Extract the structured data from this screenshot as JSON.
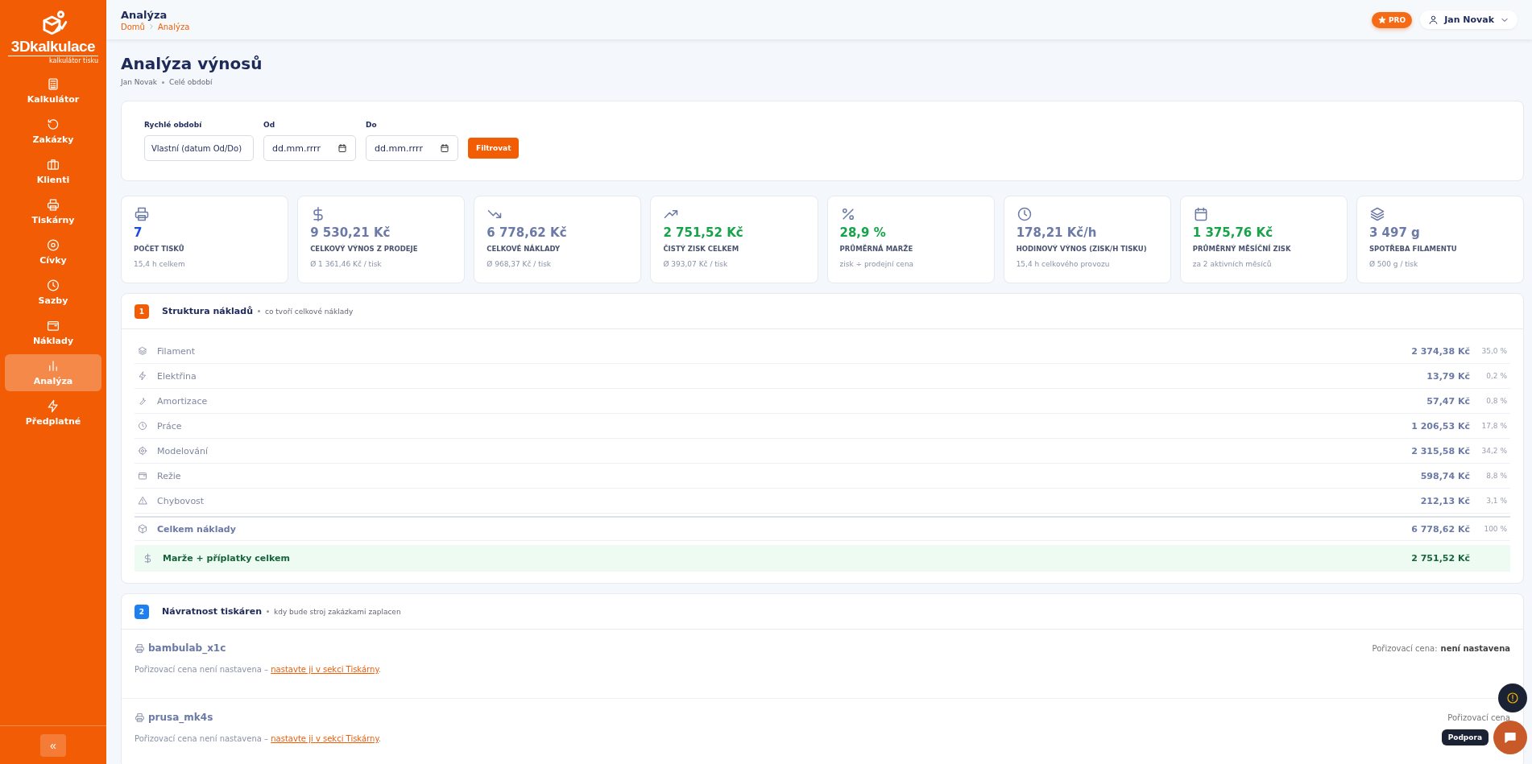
{
  "brand": {
    "name": "3Dkalkulace",
    "tagline": "kalkulátor tisku"
  },
  "sidebar": {
    "items": [
      {
        "label": "Kalkulátor",
        "selected": false
      },
      {
        "label": "Zakázky",
        "selected": false
      },
      {
        "label": "Klienti",
        "selected": false
      },
      {
        "label": "Tiskárny",
        "selected": false
      },
      {
        "label": "Cívky",
        "selected": false
      },
      {
        "label": "Sazby",
        "selected": false
      },
      {
        "label": "Náklady",
        "selected": false
      },
      {
        "label": "Analýza",
        "selected": true
      },
      {
        "label": "Předplatné",
        "selected": false
      }
    ],
    "collapse": "«"
  },
  "header": {
    "title": "Analýza",
    "breadcrumb": [
      "Domů",
      "Analýza"
    ],
    "pro": "PRO",
    "user": "Jan Novak"
  },
  "page": {
    "title": "Analýza výnosů",
    "meta": [
      "Jan Novak",
      "Celé období"
    ]
  },
  "filter": {
    "fields": [
      {
        "kind": "select",
        "label": "Rychlé období",
        "value": "Vlastní (datum Od/Do)"
      },
      {
        "kind": "date",
        "label": "Od",
        "placeholder": "dd.mm.rrrr"
      },
      {
        "kind": "date",
        "label": "Do",
        "placeholder": "dd.mm.rrrr"
      }
    ],
    "button": "Filtrovat"
  },
  "stats": [
    {
      "value": "7",
      "label": "POČET TISKŮ",
      "note": "15,4 h celkem",
      "color": "#1d4ed8"
    },
    {
      "value": "9 530,21 Kč",
      "label": "CELKOVÝ VÝNOS Z PRODEJE",
      "note": "Ø 1 361,46 Kč / tisk",
      "color": "#6b7aa6"
    },
    {
      "value": "6 778,62 Kč",
      "label": "CELKOVÉ NÁKLADY",
      "note": "Ø 968,37 Kč / tisk",
      "color": "#6b7aa6"
    },
    {
      "value": "2 751,52 Kč",
      "label": "ČISTÝ ZISK CELKEM",
      "note": "Ø 393,07 Kč / tisk",
      "color": "#16a34a"
    },
    {
      "value": "28,9 %",
      "label": "PRŮMĚRNÁ MARŽE",
      "note": "zisk ÷ prodejní cena",
      "color": "#16a34a"
    },
    {
      "value": "178,21 Kč/h",
      "label": "HODINOVÝ VÝNOS (ZISK/H TISKU)",
      "note": "15,4 h celkového provozu",
      "color": "#6b7aa6"
    },
    {
      "value": "1 375,76 Kč",
      "label": "PRŮMĚRNÝ MĚSÍČNÍ ZISK",
      "note": "za 2 aktivních měsíců",
      "color": "#16a34a"
    },
    {
      "value": "3 497 g",
      "label": "SPOTŘEBA FILAMENTU",
      "note": "Ø 500 g / tisk",
      "color": "#6b7aa6"
    }
  ],
  "costs": {
    "number": "1",
    "color": "#f25c05",
    "title": "Struktura nákladů",
    "subtitle": "co tvoří celkové náklady",
    "rows": [
      {
        "label": "Filament",
        "amount": "2 374,38 Kč",
        "share": "35,0 %"
      },
      {
        "label": "Elektřina",
        "amount": "13,79 Kč",
        "share": "0,2 %"
      },
      {
        "label": "Amortizace",
        "amount": "57,47 Kč",
        "share": "0,8 %"
      },
      {
        "label": "Práce",
        "amount": "1 206,53 Kč",
        "share": "17,8 %"
      },
      {
        "label": "Modelování",
        "amount": "2 315,58 Kč",
        "share": "34,2 %"
      },
      {
        "label": "Režie",
        "amount": "598,74 Kč",
        "share": "8,8 %"
      },
      {
        "label": "Chybovost",
        "amount": "212,13 Kč",
        "share": "3,1 %"
      }
    ],
    "total": {
      "label": "Celkem náklady",
      "amount": "6 778,62 Kč",
      "share": "100 %"
    },
    "margin": {
      "label": "Marže + příplatky celkem",
      "amount": "2 751,52 Kč"
    }
  },
  "payback": {
    "number": "2",
    "color": "#1d7ff0",
    "title": "Návratnost tiskáren",
    "subtitle": "kdy bude stroj zakázkami zaplacen",
    "printers": [
      {
        "name": "bambulab_x1c",
        "price_label": "Pořizovací cena:",
        "price_value": "není nastavena",
        "note": "Pořizovací cena není nastavena –",
        "link": "nastavte ji v sekci Tiskárny",
        "end": "."
      },
      {
        "name": "prusa_mk4s",
        "price_label": "Pořizovací cena",
        "note": "Pořizovací cena není nastavena –",
        "link": "nastavte ji v sekci Tiskárny",
        "end": "."
      }
    ]
  },
  "support": {
    "label": "Podpora"
  }
}
